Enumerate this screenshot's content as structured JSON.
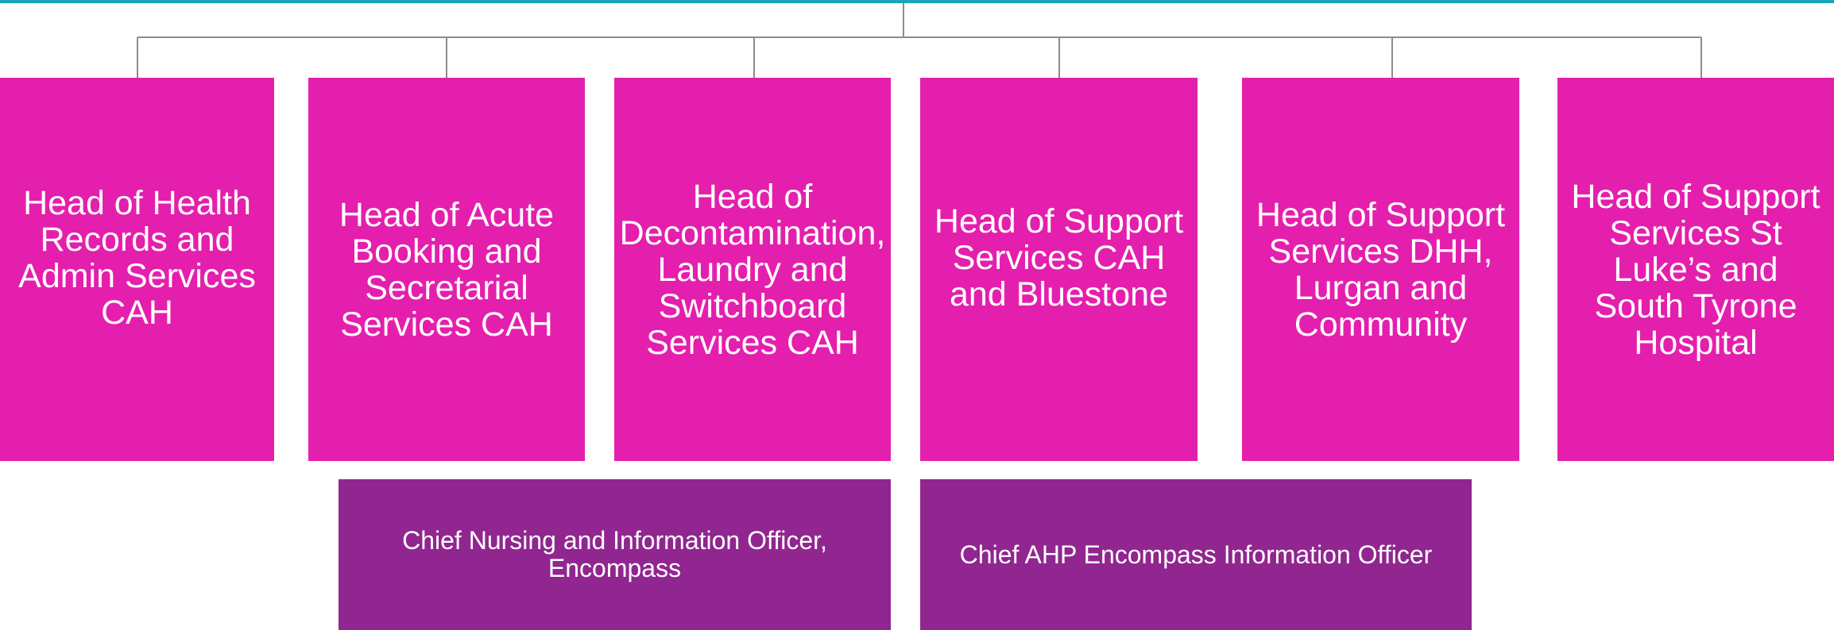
{
  "colors": {
    "top_rule": "#1aa5b8",
    "connector": "#8c8c8c",
    "head_box": "#e41fad",
    "officer_box": "#912690",
    "text": "#ffffff"
  },
  "heads": [
    {
      "label": "Head of Health Records and Admin Services CAH"
    },
    {
      "label": "Head of Acute Booking and Secretarial Services CAH"
    },
    {
      "label": "Head of Decontamination, Laundry and Switchboard Services CAH"
    },
    {
      "label": "Head of Support Services CAH and Bluestone"
    },
    {
      "label": "Head of Support Services DHH, Lurgan and Community"
    },
    {
      "label": "Head of Support Services St Luke’s and South Tyrone Hospital"
    }
  ],
  "officers": [
    {
      "label": "Chief Nursing and Information Officer, Encompass"
    },
    {
      "label": "Chief AHP Encompass Information Officer"
    }
  ]
}
